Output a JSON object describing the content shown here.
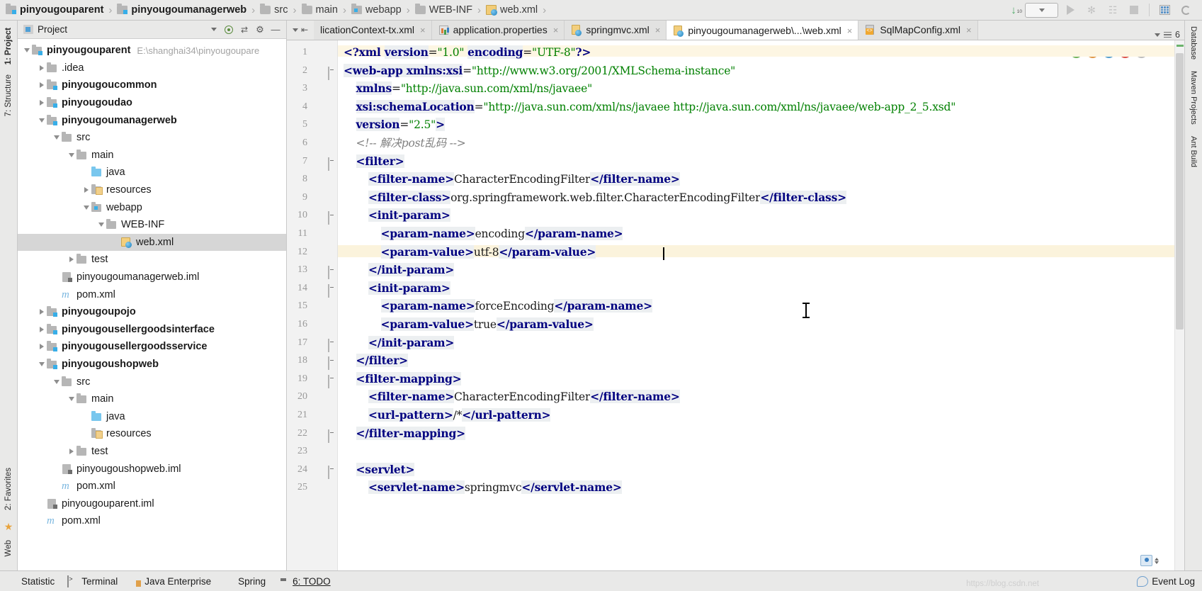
{
  "breadcrumb": {
    "items": [
      {
        "label": "pinyougouparent",
        "icon": "module-icon",
        "bold": true
      },
      {
        "label": "pinyougoumanagerweb",
        "icon": "module-icon",
        "bold": true
      },
      {
        "label": "src",
        "icon": "folder-icon",
        "bold": false
      },
      {
        "label": "main",
        "icon": "folder-icon",
        "bold": false
      },
      {
        "label": "webapp",
        "icon": "webapp-folder-icon",
        "bold": false
      },
      {
        "label": "WEB-INF",
        "icon": "folder-icon",
        "bold": false
      },
      {
        "label": "web.xml",
        "icon": "web-xml-icon",
        "bold": false
      }
    ],
    "separator": "›"
  },
  "toolbar": {
    "sort_numeric_digits": [
      "01",
      "10",
      "01"
    ],
    "run_config_placeholder": "",
    "buttons": [
      "run-button",
      "debug-button",
      "run-coverage-button",
      "stop-button",
      "database-button",
      "refresh-button"
    ]
  },
  "left_tool_strip": {
    "tabs": [
      {
        "label": "1: Project",
        "active": true
      },
      {
        "label": "7: Structure",
        "active": false
      },
      {
        "label": "2: Favorites",
        "active": false
      },
      {
        "label": "Web",
        "active": false
      }
    ]
  },
  "right_tool_strip": {
    "tabs": [
      {
        "label": "Database"
      },
      {
        "label": "Maven Projects"
      },
      {
        "label": "Ant Build"
      }
    ]
  },
  "project_panel": {
    "title": "Project",
    "header_buttons": [
      "locate-in-tree-icon",
      "collapse-all-icon",
      "settings-gear-icon",
      "hide-panel-icon"
    ],
    "tree": [
      {
        "depth": 0,
        "twisty": "down",
        "icon": "module-icon",
        "label": "pinyougouparent",
        "bold": true,
        "path": "E:\\shanghai34\\pinyougoupare",
        "selected": false
      },
      {
        "depth": 1,
        "twisty": "right",
        "icon": "folder-icon",
        "label": ".idea",
        "bold": false,
        "path": "",
        "selected": false
      },
      {
        "depth": 1,
        "twisty": "right",
        "icon": "module-icon",
        "label": "pinyougoucommon",
        "bold": true,
        "path": "",
        "selected": false
      },
      {
        "depth": 1,
        "twisty": "right",
        "icon": "module-icon",
        "label": "pinyougoudao",
        "bold": true,
        "path": "",
        "selected": false
      },
      {
        "depth": 1,
        "twisty": "down",
        "icon": "module-icon",
        "label": "pinyougoumanagerweb",
        "bold": true,
        "path": "",
        "selected": false
      },
      {
        "depth": 2,
        "twisty": "down",
        "icon": "folder-icon",
        "label": "src",
        "bold": false,
        "path": "",
        "selected": false
      },
      {
        "depth": 3,
        "twisty": "down",
        "icon": "folder-icon",
        "label": "main",
        "bold": false,
        "path": "",
        "selected": false
      },
      {
        "depth": 4,
        "twisty": "none",
        "icon": "source-folder-icon",
        "label": "java",
        "bold": false,
        "path": "",
        "selected": false
      },
      {
        "depth": 4,
        "twisty": "right",
        "icon": "resources-folder-icon",
        "label": "resources",
        "bold": false,
        "path": "",
        "selected": false
      },
      {
        "depth": 4,
        "twisty": "down",
        "icon": "webapp-folder-icon",
        "label": "webapp",
        "bold": false,
        "path": "",
        "selected": false
      },
      {
        "depth": 5,
        "twisty": "down",
        "icon": "folder-icon",
        "label": "WEB-INF",
        "bold": false,
        "path": "",
        "selected": false
      },
      {
        "depth": 6,
        "twisty": "none",
        "icon": "web-xml-icon",
        "label": "web.xml",
        "bold": false,
        "path": "",
        "selected": true
      },
      {
        "depth": 3,
        "twisty": "right",
        "icon": "folder-icon",
        "label": "test",
        "bold": false,
        "path": "",
        "selected": false
      },
      {
        "depth": 2,
        "twisty": "none",
        "icon": "iml-file-icon",
        "label": "pinyougoumanagerweb.iml",
        "bold": false,
        "path": "",
        "selected": false
      },
      {
        "depth": 2,
        "twisty": "none",
        "icon": "maven-pom-icon",
        "label": "pom.xml",
        "bold": false,
        "path": "",
        "selected": false
      },
      {
        "depth": 1,
        "twisty": "right",
        "icon": "module-icon",
        "label": "pinyougoupojo",
        "bold": true,
        "path": "",
        "selected": false
      },
      {
        "depth": 1,
        "twisty": "right",
        "icon": "module-icon",
        "label": "pinyougousellergoodsinterface",
        "bold": true,
        "path": "",
        "selected": false
      },
      {
        "depth": 1,
        "twisty": "right",
        "icon": "module-icon",
        "label": "pinyougousellergoodsservice",
        "bold": true,
        "path": "",
        "selected": false
      },
      {
        "depth": 1,
        "twisty": "down",
        "icon": "module-icon",
        "label": "pinyougoushopweb",
        "bold": true,
        "path": "",
        "selected": false
      },
      {
        "depth": 2,
        "twisty": "down",
        "icon": "folder-icon",
        "label": "src",
        "bold": false,
        "path": "",
        "selected": false
      },
      {
        "depth": 3,
        "twisty": "down",
        "icon": "folder-icon",
        "label": "main",
        "bold": false,
        "path": "",
        "selected": false
      },
      {
        "depth": 4,
        "twisty": "none",
        "icon": "source-folder-icon",
        "label": "java",
        "bold": false,
        "path": "",
        "selected": false
      },
      {
        "depth": 4,
        "twisty": "none",
        "icon": "resources-folder-icon",
        "label": "resources",
        "bold": false,
        "path": "",
        "selected": false
      },
      {
        "depth": 3,
        "twisty": "right",
        "icon": "folder-icon",
        "label": "test",
        "bold": false,
        "path": "",
        "selected": false
      },
      {
        "depth": 2,
        "twisty": "none",
        "icon": "iml-file-icon",
        "label": "pinyougoushopweb.iml",
        "bold": false,
        "path": "",
        "selected": false
      },
      {
        "depth": 2,
        "twisty": "none",
        "icon": "maven-pom-icon",
        "label": "pom.xml",
        "bold": false,
        "path": "",
        "selected": false
      },
      {
        "depth": 1,
        "twisty": "none",
        "icon": "iml-file-icon",
        "label": "pinyougouparent.iml",
        "bold": false,
        "path": "",
        "selected": false
      },
      {
        "depth": 1,
        "twisty": "none",
        "icon": "maven-pom-icon",
        "label": "pom.xml",
        "bold": false,
        "path": "",
        "selected": false
      }
    ]
  },
  "editor_tabs": {
    "close_glyph": "×",
    "items": [
      {
        "label": "licationContext-tx.xml",
        "icon": "xml-file-icon",
        "active": false,
        "truncated": true
      },
      {
        "label": "application.properties",
        "icon": "properties-file-icon",
        "active": false,
        "truncated": false
      },
      {
        "label": "springmvc.xml",
        "icon": "web-xml-icon",
        "active": false,
        "truncated": false
      },
      {
        "label": "pinyougoumanagerweb\\...\\web.xml",
        "icon": "web-xml-icon",
        "active": true,
        "truncated": false
      },
      {
        "label": "SqlMapConfig.xml",
        "icon": "sql-xml-icon",
        "active": false,
        "truncated": false
      }
    ],
    "overflow_count": "6"
  },
  "code": {
    "language": "XML",
    "file": "web.xml",
    "line_numbers": [
      "1",
      "2",
      "3",
      "4",
      "5",
      "6",
      "7",
      "8",
      "9",
      "10",
      "11",
      "12",
      "13",
      "14",
      "15",
      "16",
      "17",
      "18",
      "19",
      "20",
      "21",
      "22",
      "23",
      "24",
      "25"
    ],
    "lines": [
      {
        "num": "1",
        "indent": 0,
        "fold": "none",
        "segs": [
          {
            "t": "<?xml ",
            "c": "pi"
          },
          {
            "t": "version",
            "c": "att"
          },
          {
            "t": "=",
            "c": "txt"
          },
          {
            "t": "\"1.0\"",
            "c": "val"
          },
          {
            "t": " ",
            "c": "txt"
          },
          {
            "t": "encoding",
            "c": "att"
          },
          {
            "t": "=",
            "c": "txt"
          },
          {
            "t": "\"UTF-8\"",
            "c": "val"
          },
          {
            "t": "?>",
            "c": "pi"
          }
        ]
      },
      {
        "num": "2",
        "indent": 0,
        "fold": "down",
        "segs": [
          {
            "t": "<web-app ",
            "c": "tag"
          },
          {
            "t": "xmlns:xsi",
            "c": "att"
          },
          {
            "t": "=",
            "c": "txt"
          },
          {
            "t": "\"http://www.w3.org/2001/XMLSchema-instance\"",
            "c": "val"
          }
        ]
      },
      {
        "num": "3",
        "indent": 1,
        "fold": "none",
        "segs": [
          {
            "t": "xmlns",
            "c": "att"
          },
          {
            "t": "=",
            "c": "txt"
          },
          {
            "t": "\"http://java.sun.com/xml/ns/javaee\"",
            "c": "val"
          }
        ]
      },
      {
        "num": "4",
        "indent": 1,
        "fold": "none",
        "segs": [
          {
            "t": "xsi:schemaLocation",
            "c": "att"
          },
          {
            "t": "=",
            "c": "txt"
          },
          {
            "t": "\"http://java.sun.com/xml/ns/javaee http://java.sun.com/xml/ns/javaee/web-app_2_5.xsd\"",
            "c": "val"
          }
        ]
      },
      {
        "num": "5",
        "indent": 1,
        "fold": "none",
        "segs": [
          {
            "t": "version",
            "c": "att"
          },
          {
            "t": "=",
            "c": "txt"
          },
          {
            "t": "\"2.5\"",
            "c": "val"
          },
          {
            "t": ">",
            "c": "tag"
          }
        ]
      },
      {
        "num": "6",
        "indent": 1,
        "fold": "none",
        "segs": [
          {
            "t": "<!-- 解决post乱码 -->",
            "c": "cmt"
          }
        ]
      },
      {
        "num": "7",
        "indent": 1,
        "fold": "down",
        "segs": [
          {
            "t": "<filter>",
            "c": "tag"
          }
        ]
      },
      {
        "num": "8",
        "indent": 2,
        "fold": "none",
        "segs": [
          {
            "t": "<filter-name>",
            "c": "tag"
          },
          {
            "t": "CharacterEncodingFilter",
            "c": "txt"
          },
          {
            "t": "</filter-name>",
            "c": "tag"
          }
        ]
      },
      {
        "num": "9",
        "indent": 2,
        "fold": "none",
        "segs": [
          {
            "t": "<filter-class>",
            "c": "tag"
          },
          {
            "t": "org.springframework.web.filter.CharacterEncodingFilter",
            "c": "txt"
          },
          {
            "t": "</filter-class>",
            "c": "tag"
          }
        ]
      },
      {
        "num": "10",
        "indent": 2,
        "fold": "down",
        "segs": [
          {
            "t": "<init-param>",
            "c": "tag"
          }
        ]
      },
      {
        "num": "11",
        "indent": 3,
        "fold": "none",
        "segs": [
          {
            "t": "<param-name>",
            "c": "tag"
          },
          {
            "t": "encoding",
            "c": "txt"
          },
          {
            "t": "</param-name>",
            "c": "tag"
          }
        ]
      },
      {
        "num": "12",
        "indent": 3,
        "fold": "none",
        "segs": [
          {
            "t": "<param-value>",
            "c": "tag"
          },
          {
            "t": "utf-8",
            "c": "txt"
          },
          {
            "t": "</param-value>",
            "c": "tag"
          }
        ]
      },
      {
        "num": "13",
        "indent": 2,
        "fold": "up",
        "segs": [
          {
            "t": "</init-param>",
            "c": "tag"
          }
        ]
      },
      {
        "num": "14",
        "indent": 2,
        "fold": "down",
        "segs": [
          {
            "t": "<init-param>",
            "c": "tag"
          }
        ]
      },
      {
        "num": "15",
        "indent": 3,
        "fold": "none",
        "segs": [
          {
            "t": "<param-name>",
            "c": "tag"
          },
          {
            "t": "forceEncoding",
            "c": "txt"
          },
          {
            "t": "</param-name>",
            "c": "tag"
          }
        ]
      },
      {
        "num": "16",
        "indent": 3,
        "fold": "none",
        "segs": [
          {
            "t": "<param-value>",
            "c": "tag"
          },
          {
            "t": "true",
            "c": "txt"
          },
          {
            "t": "</param-value>",
            "c": "tag"
          }
        ]
      },
      {
        "num": "17",
        "indent": 2,
        "fold": "up",
        "segs": [
          {
            "t": "</init-param>",
            "c": "tag"
          }
        ]
      },
      {
        "num": "18",
        "indent": 1,
        "fold": "up",
        "segs": [
          {
            "t": "</filter>",
            "c": "tag"
          }
        ]
      },
      {
        "num": "19",
        "indent": 1,
        "fold": "down",
        "segs": [
          {
            "t": "<filter-mapping>",
            "c": "tag"
          }
        ]
      },
      {
        "num": "20",
        "indent": 2,
        "fold": "none",
        "segs": [
          {
            "t": "<filter-name>",
            "c": "tag"
          },
          {
            "t": "CharacterEncodingFilter",
            "c": "txt"
          },
          {
            "t": "</filter-name>",
            "c": "tag"
          }
        ]
      },
      {
        "num": "21",
        "indent": 2,
        "fold": "none",
        "segs": [
          {
            "t": "<url-pattern>",
            "c": "tag"
          },
          {
            "t": "/*",
            "c": "txt"
          },
          {
            "t": "</url-pattern>",
            "c": "tag"
          }
        ]
      },
      {
        "num": "22",
        "indent": 1,
        "fold": "up",
        "segs": [
          {
            "t": "</filter-mapping>",
            "c": "tag"
          }
        ]
      },
      {
        "num": "23",
        "indent": 0,
        "fold": "none",
        "segs": []
      },
      {
        "num": "24",
        "indent": 1,
        "fold": "down",
        "segs": [
          {
            "t": "<servlet>",
            "c": "tag"
          }
        ]
      },
      {
        "num": "25",
        "indent": 2,
        "fold": "none",
        "segs": [
          {
            "t": "<servlet-name>",
            "c": "tag"
          },
          {
            "t": "springmvc",
            "c": "txt"
          },
          {
            "t": "</servlet-name>",
            "c": "tag"
          }
        ]
      }
    ],
    "caret_line": "12",
    "inspection_widgets": [
      "validate-icon",
      "preview-icon",
      "browser-icon",
      "error-circle-icon",
      "settings-icon"
    ]
  },
  "status_bar": {
    "items": [
      {
        "label": "Statistic",
        "icon": "statistic-icon",
        "mnemonic": ""
      },
      {
        "label": "Terminal",
        "icon": "terminal-icon",
        "mnemonic": ""
      },
      {
        "label": "Java Enterprise",
        "icon": "java-enterprise-icon",
        "mnemonic": ""
      },
      {
        "label": "Spring",
        "icon": "spring-icon",
        "mnemonic": ""
      },
      {
        "label": "6: TODO",
        "icon": "todo-icon",
        "mnemonic": "6"
      }
    ],
    "event_log": "Event Log",
    "watermark": "https://blog.csdn.net"
  }
}
